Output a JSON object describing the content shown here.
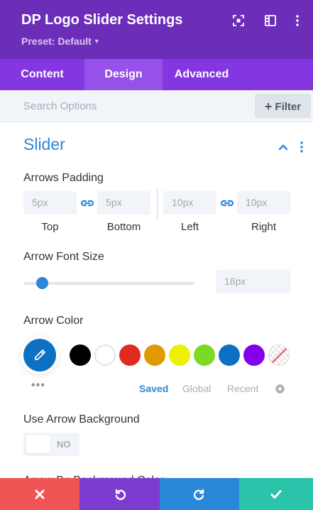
{
  "header": {
    "title": "DP Logo Slider Settings",
    "preset": "Preset: Default",
    "icons": [
      "focus-icon",
      "sidebar-toggle-icon",
      "more-vertical-icon"
    ]
  },
  "tabs": [
    {
      "label": "Content",
      "active": false
    },
    {
      "label": "Design",
      "active": true
    },
    {
      "label": "Advanced",
      "active": false
    }
  ],
  "search": {
    "placeholder": "Search Options",
    "filter_label": "Filter"
  },
  "section": {
    "title": "Slider"
  },
  "arrows_padding": {
    "label": "Arrows Padding",
    "top": {
      "value": "5px",
      "label": "Top"
    },
    "bottom": {
      "value": "5px",
      "label": "Bottom"
    },
    "left": {
      "value": "10px",
      "label": "Left"
    },
    "right": {
      "value": "10px",
      "label": "Right"
    }
  },
  "arrow_font_size": {
    "label": "Arrow Font Size",
    "value": "18px",
    "slider_fraction": 0.11
  },
  "arrow_color": {
    "label": "Arrow Color",
    "selected": "#0c71c3",
    "swatches": [
      "#000000",
      "#ffffff",
      "#e02b20",
      "#e09900",
      "#edf000",
      "#7cda24",
      "#0c71c3",
      "#8300e9",
      "transparent"
    ],
    "tabs": {
      "saved": "Saved",
      "global": "Global",
      "recent": "Recent"
    }
  },
  "use_arrow_background": {
    "label": "Use Arrow Background",
    "value": "NO"
  },
  "next_label": "Arrow Bg Background Color",
  "colors": {
    "header": "#6c2eb9",
    "tabs": "#8436e0",
    "active_tab": "#9551ea",
    "accent": "#2b87da",
    "cancel": "#ef5555",
    "undo": "#7d3bcf",
    "redo": "#2b87da",
    "save": "#29c4a9"
  }
}
